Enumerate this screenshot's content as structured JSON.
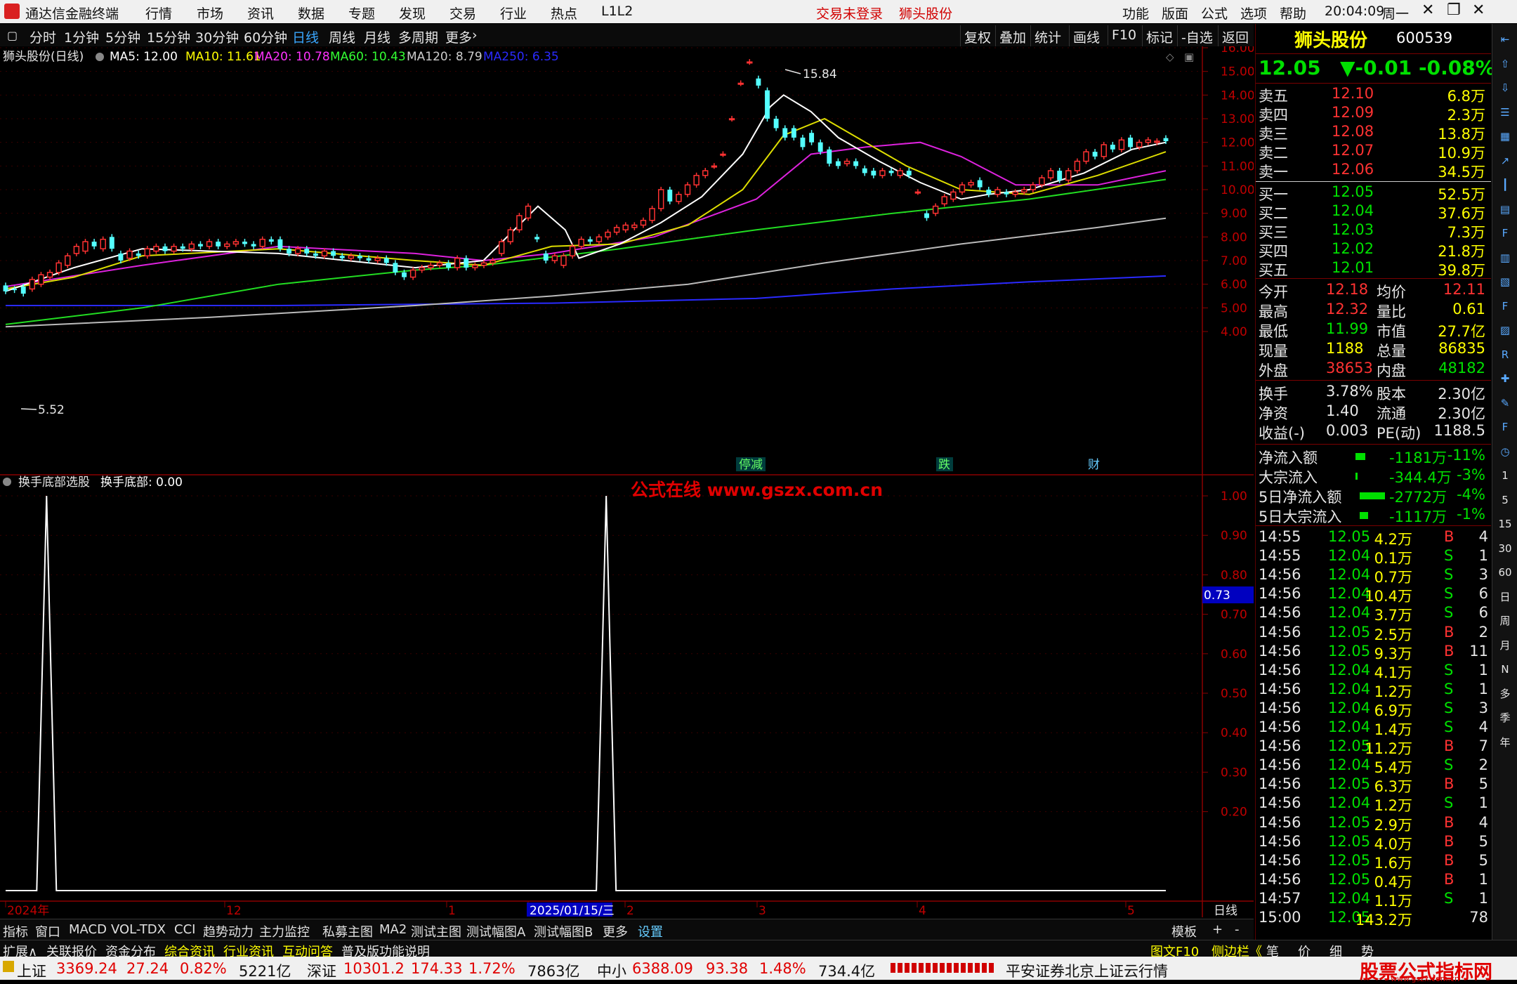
{
  "titlebar": {
    "app_name": "通达信金融终端",
    "menus": [
      "行情",
      "市场",
      "资讯",
      "数据",
      "专题",
      "发现",
      "交易",
      "行业",
      "热点",
      "L1L2"
    ],
    "login_status": "交易未登录",
    "stock_name": "狮头股份",
    "right_menus": [
      "功能",
      "版面",
      "公式",
      "选项",
      "帮助"
    ],
    "time": "20:04:09",
    "weekday": "周一"
  },
  "toolbar": {
    "periods": [
      "分时",
      "1分钟",
      "5分钟",
      "15分钟",
      "30分钟",
      "60分钟",
      "日线",
      "周线",
      "月线",
      "多周期",
      "更多"
    ],
    "active_period": "日线",
    "right_buttons": [
      "复权",
      "叠加",
      "统计",
      "画线",
      "F10",
      "标记",
      "-自选",
      "返回"
    ]
  },
  "main_chart": {
    "title": "狮头股份(日线)",
    "ma_labels": [
      {
        "text": "MA5: 12.00",
        "color": "#ffffff"
      },
      {
        "text": "MA10: 11.61",
        "color": "#ffff00"
      },
      {
        "text": "MA20: 10.78",
        "color": "#ff33ff"
      },
      {
        "text": "MA60: 10.43",
        "color": "#33ff33"
      },
      {
        "text": "MA120: 8.79",
        "color": "#cccccc"
      },
      {
        "text": "MA250: 6.35",
        "color": "#2a2aff"
      }
    ],
    "high_label": "15.84",
    "low_label": "5.52",
    "event_labels": [
      "停减",
      "跌",
      "财"
    ],
    "price_ticks": [
      "16.00",
      "15.00",
      "14.00",
      "13.00",
      "12.00",
      "11.00",
      "10.00",
      "9.00",
      "8.00",
      "7.00",
      "6.00",
      "5.00",
      "4.00"
    ]
  },
  "sub_chart": {
    "title": "换手底部选股",
    "value_label": "换手底部: 0.00",
    "watermark": "公式在线  www.gszx.com.cn",
    "ticks": [
      "1.00",
      "0.90",
      "0.80",
      "0.70",
      "0.60",
      "0.50",
      "0.40",
      "0.30",
      "0.20"
    ],
    "cursor_value": "0.73"
  },
  "x_axis": {
    "labels": [
      "2024年",
      "12",
      "1",
      "2025/01/15/三",
      "2",
      "3",
      "4",
      "5"
    ],
    "period_label": "日线"
  },
  "chart_data": {
    "type": "candlestick",
    "title": "狮头股份(日线)",
    "ylim": [
      4.0,
      16.0
    ],
    "candles": [
      {
        "o": 5.95,
        "c": 5.7
      },
      {
        "o": 5.8,
        "c": 5.75
      },
      {
        "o": 5.9,
        "c": 5.6
      },
      {
        "o": 5.8,
        "c": 6.2
      },
      {
        "o": 6.0,
        "c": 6.4
      },
      {
        "o": 6.3,
        "c": 6.5
      },
      {
        "o": 6.5,
        "c": 6.9
      },
      {
        "o": 6.8,
        "c": 7.2
      },
      {
        "o": 7.3,
        "c": 7.6
      },
      {
        "o": 7.4,
        "c": 7.8
      },
      {
        "o": 7.8,
        "c": 7.6
      },
      {
        "o": 7.5,
        "c": 7.9
      },
      {
        "o": 8.0,
        "c": 7.5
      },
      {
        "o": 7.3,
        "c": 7.0
      },
      {
        "o": 7.1,
        "c": 7.4
      },
      {
        "o": 7.3,
        "c": 7.2
      },
      {
        "o": 7.2,
        "c": 7.5
      },
      {
        "o": 7.4,
        "c": 7.6
      },
      {
        "o": 7.6,
        "c": 7.4
      },
      {
        "o": 7.4,
        "c": 7.6
      },
      {
        "o": 7.6,
        "c": 7.5
      },
      {
        "o": 7.5,
        "c": 7.7
      },
      {
        "o": 7.7,
        "c": 7.6
      },
      {
        "o": 7.6,
        "c": 7.8
      },
      {
        "o": 7.8,
        "c": 7.6
      },
      {
        "o": 7.6,
        "c": 7.7
      },
      {
        "o": 7.7,
        "c": 7.8
      },
      {
        "o": 7.8,
        "c": 7.7
      },
      {
        "o": 7.7,
        "c": 7.6
      },
      {
        "o": 7.6,
        "c": 7.9
      },
      {
        "o": 7.9,
        "c": 7.8
      },
      {
        "o": 7.9,
        "c": 7.5
      },
      {
        "o": 7.5,
        "c": 7.3
      },
      {
        "o": 7.3,
        "c": 7.5
      },
      {
        "o": 7.5,
        "c": 7.3
      },
      {
        "o": 7.3,
        "c": 7.2
      },
      {
        "o": 7.2,
        "c": 7.4
      },
      {
        "o": 7.4,
        "c": 7.2
      },
      {
        "o": 7.2,
        "c": 7.1
      },
      {
        "o": 7.1,
        "c": 7.2
      },
      {
        "o": 7.2,
        "c": 7.1
      },
      {
        "o": 7.1,
        "c": 7.0
      },
      {
        "o": 7.0,
        "c": 7.1
      },
      {
        "o": 7.1,
        "c": 6.9
      },
      {
        "o": 6.9,
        "c": 6.5
      },
      {
        "o": 6.5,
        "c": 6.3
      },
      {
        "o": 6.3,
        "c": 6.6
      },
      {
        "o": 6.6,
        "c": 6.7
      },
      {
        "o": 6.7,
        "c": 6.8
      },
      {
        "o": 6.8,
        "c": 6.9
      },
      {
        "o": 6.9,
        "c": 6.7
      },
      {
        "o": 6.7,
        "c": 7.1
      },
      {
        "o": 7.1,
        "c": 6.7
      },
      {
        "o": 6.7,
        "c": 6.8
      },
      {
        "o": 6.8,
        "c": 6.9
      },
      {
        "o": 6.9,
        "c": 7.0
      },
      {
        "o": 7.3,
        "c": 7.8
      },
      {
        "o": 7.8,
        "c": 8.3
      },
      {
        "o": 8.3,
        "c": 8.9
      },
      {
        "o": 8.8,
        "c": 9.3
      },
      {
        "o": 8.0,
        "c": 7.9
      },
      {
        "o": 7.3,
        "c": 7.0
      },
      {
        "o": 7.0,
        "c": 7.2
      },
      {
        "o": 6.8,
        "c": 7.2
      },
      {
        "o": 7.2,
        "c": 7.6
      },
      {
        "o": 7.6,
        "c": 7.9
      },
      {
        "o": 7.9,
        "c": 7.8
      },
      {
        "o": 7.8,
        "c": 8.0
      },
      {
        "o": 8.0,
        "c": 8.2
      },
      {
        "o": 8.2,
        "c": 8.4
      },
      {
        "o": 8.3,
        "c": 8.5
      },
      {
        "o": 8.4,
        "c": 8.5
      },
      {
        "o": 8.5,
        "c": 8.7
      },
      {
        "o": 8.7,
        "c": 9.2
      },
      {
        "o": 9.2,
        "c": 10.0
      },
      {
        "o": 10.0,
        "c": 9.5
      },
      {
        "o": 9.5,
        "c": 9.8
      },
      {
        "o": 9.8,
        "c": 10.2
      },
      {
        "o": 10.2,
        "c": 10.6
      },
      {
        "o": 10.6,
        "c": 10.8
      },
      {
        "o": 11.0,
        "c": 11.0
      },
      {
        "o": 11.5,
        "c": 11.5
      },
      {
        "o": 13.0,
        "c": 13.0
      },
      {
        "o": 14.5,
        "c": 14.5
      },
      {
        "o": 15.4,
        "c": 15.4
      },
      {
        "o": 14.7,
        "c": 14.4
      },
      {
        "o": 14.2,
        "c": 13.0
      },
      {
        "o": 13.0,
        "c": 12.6
      },
      {
        "o": 12.6,
        "c": 12.2
      },
      {
        "o": 12.6,
        "c": 12.2
      },
      {
        "o": 12.2,
        "c": 11.8
      },
      {
        "o": 12.4,
        "c": 12.0
      },
      {
        "o": 12.0,
        "c": 11.6
      },
      {
        "o": 11.7,
        "c": 11.1
      },
      {
        "o": 11.2,
        "c": 11.0
      },
      {
        "o": 11.1,
        "c": 11.2
      },
      {
        "o": 11.2,
        "c": 11.0
      },
      {
        "o": 10.9,
        "c": 10.7
      },
      {
        "o": 10.8,
        "c": 10.6
      },
      {
        "o": 10.6,
        "c": 10.8
      },
      {
        "o": 10.8,
        "c": 10.7
      },
      {
        "o": 10.6,
        "c": 10.8
      },
      {
        "o": 10.8,
        "c": 10.6
      },
      {
        "o": 9.9,
        "c": 9.9
      },
      {
        "o": 9.0,
        "c": 8.8
      },
      {
        "o": 9.0,
        "c": 9.3
      },
      {
        "o": 9.4,
        "c": 9.7
      },
      {
        "o": 9.6,
        "c": 9.9
      },
      {
        "o": 9.9,
        "c": 10.2
      },
      {
        "o": 10.2,
        "c": 10.3
      },
      {
        "o": 10.4,
        "c": 10.1
      },
      {
        "o": 10.0,
        "c": 9.8
      },
      {
        "o": 9.8,
        "c": 10.0
      },
      {
        "o": 9.9,
        "c": 9.8
      },
      {
        "o": 9.8,
        "c": 9.9
      },
      {
        "o": 9.9,
        "c": 10.0
      },
      {
        "o": 10.0,
        "c": 10.2
      },
      {
        "o": 10.2,
        "c": 10.5
      },
      {
        "o": 10.5,
        "c": 10.8
      },
      {
        "o": 10.8,
        "c": 10.4
      },
      {
        "o": 10.4,
        "c": 10.8
      },
      {
        "o": 10.8,
        "c": 11.2
      },
      {
        "o": 11.2,
        "c": 11.6
      },
      {
        "o": 11.6,
        "c": 11.4
      },
      {
        "o": 11.4,
        "c": 11.9
      },
      {
        "o": 11.9,
        "c": 11.7
      },
      {
        "o": 11.7,
        "c": 12.1
      },
      {
        "o": 12.2,
        "c": 11.8
      },
      {
        "o": 11.8,
        "c": 12.0
      },
      {
        "o": 12.0,
        "c": 12.1
      },
      {
        "o": 12.0,
        "c": 12.05
      },
      {
        "o": 12.18,
        "c": 12.05
      }
    ],
    "ma5": [
      [
        0,
        5.7
      ],
      [
        10,
        6.7
      ],
      [
        20,
        7.5
      ],
      [
        40,
        7.3
      ],
      [
        60,
        6.7
      ],
      [
        70,
        7.0
      ],
      [
        78,
        9.3
      ],
      [
        82,
        8.3
      ],
      [
        84,
        7.1
      ],
      [
        90,
        7.7
      ],
      [
        96,
        8.6
      ],
      [
        102,
        9.7
      ],
      [
        108,
        11.5
      ],
      [
        112,
        13.5
      ],
      [
        114,
        14.0
      ],
      [
        118,
        13.3
      ],
      [
        122,
        12.2
      ],
      [
        128,
        11.2
      ],
      [
        134,
        10.3
      ],
      [
        140,
        9.6
      ],
      [
        144,
        9.8
      ],
      [
        150,
        10.0
      ],
      [
        158,
        10.7
      ],
      [
        165,
        11.7
      ],
      [
        170,
        12.0
      ]
    ],
    "ma10": [
      [
        0,
        5.8
      ],
      [
        10,
        6.3
      ],
      [
        20,
        7.2
      ],
      [
        40,
        7.5
      ],
      [
        60,
        7.0
      ],
      [
        70,
        6.8
      ],
      [
        80,
        7.6
      ],
      [
        90,
        7.7
      ],
      [
        100,
        8.5
      ],
      [
        108,
        10.0
      ],
      [
        114,
        12.3
      ],
      [
        120,
        13.0
      ],
      [
        126,
        12.0
      ],
      [
        132,
        11.0
      ],
      [
        140,
        10.0
      ],
      [
        150,
        9.8
      ],
      [
        160,
        10.6
      ],
      [
        170,
        11.6
      ]
    ],
    "ma20": [
      [
        0,
        5.9
      ],
      [
        20,
        6.8
      ],
      [
        40,
        7.6
      ],
      [
        60,
        7.3
      ],
      [
        70,
        7.0
      ],
      [
        80,
        7.3
      ],
      [
        95,
        8.0
      ],
      [
        110,
        9.6
      ],
      [
        118,
        11.5
      ],
      [
        126,
        11.8
      ],
      [
        134,
        12.0
      ],
      [
        140,
        11.4
      ],
      [
        148,
        10.2
      ],
      [
        160,
        10.2
      ],
      [
        170,
        10.8
      ]
    ],
    "ma60": [
      [
        0,
        4.3
      ],
      [
        20,
        5.0
      ],
      [
        40,
        6.0
      ],
      [
        60,
        6.6
      ],
      [
        70,
        6.8
      ],
      [
        90,
        7.5
      ],
      [
        110,
        8.3
      ],
      [
        130,
        9.0
      ],
      [
        150,
        9.6
      ],
      [
        170,
        10.43
      ]
    ],
    "ma120": [
      [
        0,
        4.2
      ],
      [
        30,
        4.6
      ],
      [
        60,
        5.1
      ],
      [
        80,
        5.5
      ],
      [
        100,
        6.0
      ],
      [
        120,
        6.9
      ],
      [
        140,
        7.7
      ],
      [
        160,
        8.4
      ],
      [
        170,
        8.79
      ]
    ],
    "ma250": [
      [
        0,
        5.1
      ],
      [
        40,
        5.1
      ],
      [
        80,
        5.2
      ],
      [
        110,
        5.4
      ],
      [
        130,
        5.8
      ],
      [
        150,
        6.1
      ],
      [
        170,
        6.35
      ]
    ],
    "signal_series": {
      "name": "换手底部",
      "peaks_at": [
        6,
        88
      ],
      "values_peak": 1.0
    }
  },
  "quote": {
    "name": "狮头股份",
    "code": "600539",
    "price": "12.05",
    "change": "▼-0.01",
    "change_pct": "-0.08%",
    "asks": [
      {
        "label": "卖五",
        "price": "12.10",
        "vol": "6.8万"
      },
      {
        "label": "卖四",
        "price": "12.09",
        "vol": "2.3万"
      },
      {
        "label": "卖三",
        "price": "12.08",
        "vol": "13.8万"
      },
      {
        "label": "卖二",
        "price": "12.07",
        "vol": "10.9万"
      },
      {
        "label": "卖一",
        "price": "12.06",
        "vol": "34.5万"
      }
    ],
    "bids": [
      {
        "label": "买一",
        "price": "12.05",
        "vol": "52.5万"
      },
      {
        "label": "买二",
        "price": "12.04",
        "vol": "37.6万"
      },
      {
        "label": "买三",
        "price": "12.03",
        "vol": "7.3万"
      },
      {
        "label": "买四",
        "price": "12.02",
        "vol": "21.8万"
      },
      {
        "label": "买五",
        "price": "12.01",
        "vol": "39.8万"
      }
    ],
    "stats": [
      {
        "l1": "今开",
        "v1": "12.18",
        "l2": "均价",
        "v2": "12.11"
      },
      {
        "l1": "最高",
        "v1": "12.32",
        "l2": "量比",
        "v2": "0.61"
      },
      {
        "l1": "最低",
        "v1": "11.99",
        "l2": "市值",
        "v2": "27.7亿"
      },
      {
        "l1": "现量",
        "v1": "1188",
        "l2": "总量",
        "v2": "86835"
      },
      {
        "l1": "外盘",
        "v1": "38653",
        "l2": "内盘",
        "v2": "48182"
      }
    ],
    "fundamentals": [
      {
        "l1": "换手",
        "v1": "3.78%",
        "l2": "股本",
        "v2": "2.30亿"
      },
      {
        "l1": "净资",
        "v1": "1.40",
        "l2": "流通",
        "v2": "2.30亿"
      },
      {
        "l1": "收益(-)",
        "v1": "0.003",
        "l2": "PE(动)",
        "v2": "1188.5"
      }
    ],
    "flows": [
      {
        "label": "净流入额",
        "value": "-1181万",
        "pct": "-11%",
        "bar": 0.12
      },
      {
        "label": "大宗流入",
        "value": "-344.4万",
        "pct": "-3%",
        "bar": 0.02
      },
      {
        "label": "5日净流入额",
        "value": "-2772万",
        "pct": "-4%",
        "bar": 0.3
      },
      {
        "label": "5日大宗流入",
        "value": "-1117万",
        "pct": "-1%",
        "bar": 0.1
      }
    ],
    "ticks": [
      {
        "t": "14:55",
        "p": "12.05",
        "v": "4.2万",
        "bs": "B",
        "n": "4"
      },
      {
        "t": "14:55",
        "p": "12.04",
        "v": "0.1万",
        "bs": "S",
        "n": "1"
      },
      {
        "t": "14:56",
        "p": "12.04",
        "v": "0.7万",
        "bs": "S",
        "n": "3"
      },
      {
        "t": "14:56",
        "p": "12.04",
        "v": "10.4万",
        "bs": "S",
        "n": "6"
      },
      {
        "t": "14:56",
        "p": "12.04",
        "v": "3.7万",
        "bs": "S",
        "n": "6"
      },
      {
        "t": "14:56",
        "p": "12.05",
        "v": "2.5万",
        "bs": "B",
        "n": "2"
      },
      {
        "t": "14:56",
        "p": "12.05",
        "v": "9.3万",
        "bs": "B",
        "n": "11"
      },
      {
        "t": "14:56",
        "p": "12.04",
        "v": "4.1万",
        "bs": "S",
        "n": "1"
      },
      {
        "t": "14:56",
        "p": "12.04",
        "v": "1.2万",
        "bs": "S",
        "n": "1"
      },
      {
        "t": "14:56",
        "p": "12.04",
        "v": "6.9万",
        "bs": "S",
        "n": "3"
      },
      {
        "t": "14:56",
        "p": "12.04",
        "v": "1.4万",
        "bs": "S",
        "n": "4"
      },
      {
        "t": "14:56",
        "p": "12.05",
        "v": "11.2万",
        "bs": "B",
        "n": "7"
      },
      {
        "t": "14:56",
        "p": "12.04",
        "v": "5.4万",
        "bs": "S",
        "n": "2"
      },
      {
        "t": "14:56",
        "p": "12.05",
        "v": "6.3万",
        "bs": "B",
        "n": "5"
      },
      {
        "t": "14:56",
        "p": "12.04",
        "v": "1.2万",
        "bs": "S",
        "n": "1"
      },
      {
        "t": "14:56",
        "p": "12.05",
        "v": "2.9万",
        "bs": "B",
        "n": "4"
      },
      {
        "t": "14:56",
        "p": "12.05",
        "v": "4.0万",
        "bs": "B",
        "n": "5"
      },
      {
        "t": "14:56",
        "p": "12.05",
        "v": "1.6万",
        "bs": "B",
        "n": "5"
      },
      {
        "t": "14:56",
        "p": "12.05",
        "v": "0.4万",
        "bs": "B",
        "n": "1"
      },
      {
        "t": "14:57",
        "p": "12.04",
        "v": "1.1万",
        "bs": "S",
        "n": "1"
      },
      {
        "t": "15:00",
        "p": "12.05",
        "v": "143.2万",
        "bs": "",
        "n": "78"
      }
    ]
  },
  "side_icons": [
    "pin-icon",
    "up-arrow-icon",
    "down-arrow-icon",
    "list-icon",
    "grid-icon",
    "chart-icon",
    "candle-icon",
    "book-icon",
    "f10-icon",
    "report-icon",
    "doc-icon",
    "f-icon",
    "calc-icon",
    "rsi-icon",
    "cross-icon",
    "pen-icon",
    "fs-icon",
    "clock-icon",
    "1",
    "5",
    "15",
    "30",
    "60",
    "日",
    "周",
    "月",
    "N",
    "多",
    "季",
    "年"
  ],
  "bottom_tabs": [
    "指标",
    "窗口",
    "MACD",
    "VOL-TDX",
    "CCI",
    "趋势动力",
    "主力监控",
    "私募主图",
    "MA2",
    "测试主图",
    "测试幅图A",
    "测试幅图B",
    "更多",
    "设置"
  ],
  "bottom_right": [
    "模板",
    "+",
    "-"
  ],
  "bottom_tabs2": [
    "扩展∧",
    "关联报价",
    "资金分布",
    "综合资讯",
    "行业资讯",
    "互动问答",
    "普及版功能说明"
  ],
  "right_bottom_tabs": [
    "图文F10",
    "侧边栏《",
    "笔",
    "价",
    "细",
    "势"
  ],
  "status": {
    "indices": [
      {
        "name": "上证",
        "value": "3369.24",
        "chg": "27.24",
        "pct": "0.82%",
        "amt": "5221亿"
      },
      {
        "name": "深证",
        "value": "10301.2",
        "chg": "174.33",
        "pct": "1.72%",
        "amt": "7863亿"
      },
      {
        "name": "中小",
        "value": "6388.09",
        "chg": "93.38",
        "pct": "1.48%",
        "amt": "734.4亿"
      }
    ],
    "broker": "平安证券北京上证云行情",
    "watermark": "股票公式指标网",
    "watermark_url": "www.gszx.com.cn"
  }
}
